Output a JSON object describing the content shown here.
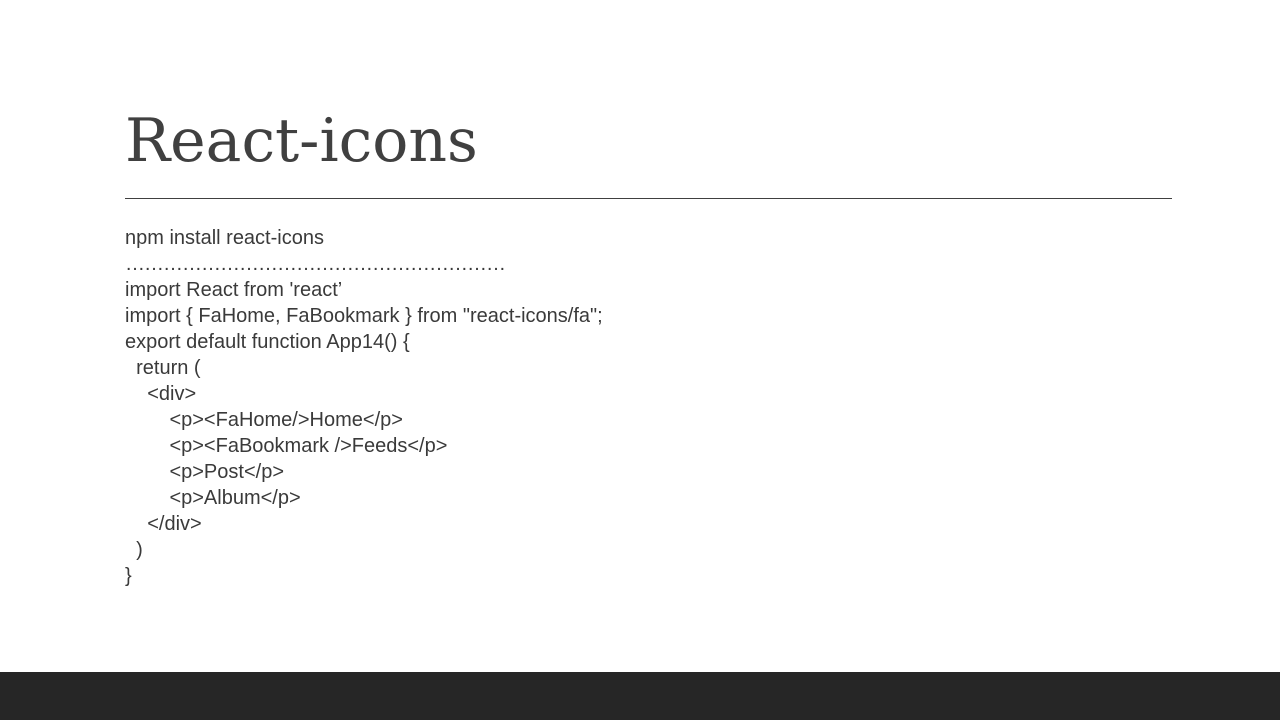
{
  "slide": {
    "title": "React-icons",
    "lines": [
      "npm install react-icons",
      "……………………………………………………",
      "import React from 'react’",
      "import { FaHome, FaBookmark } from \"react-icons/fa\";",
      "export default function App14() {",
      "  return (",
      "    <div>",
      "        <p><FaHome/>Home</p>",
      "        <p><FaBookmark />Feeds</p>",
      "        <p>Post</p>",
      "        <p>Album</p>",
      "    </div>",
      "  )",
      "}"
    ]
  },
  "colors": {
    "background": "#ffffff",
    "text": "#3a3a3a",
    "title": "#404040",
    "footer_bar": "#262626"
  }
}
